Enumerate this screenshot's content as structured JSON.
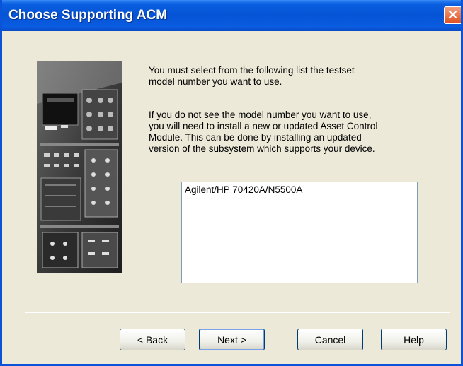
{
  "window": {
    "title": "Choose Supporting ACM",
    "close_glyph": "✕"
  },
  "side_image": {
    "icon": "test-equipment-photo"
  },
  "instructions": {
    "paragraph1_lines": [
      "You must select from the following list the testset",
      "model number you want to use."
    ],
    "paragraph2_lines": [
      "If you do not see the model number you want to use,",
      "you will need to install a new or updated Asset Control",
      "Module.  This can be done by installing an updated",
      "version of the subsystem which supports your device."
    ]
  },
  "model_list": {
    "items": [
      "Agilent/HP 70420A/N5500A"
    ]
  },
  "buttons": {
    "back": "< Back",
    "next": "Next >",
    "cancel": "Cancel",
    "help": "Help"
  }
}
